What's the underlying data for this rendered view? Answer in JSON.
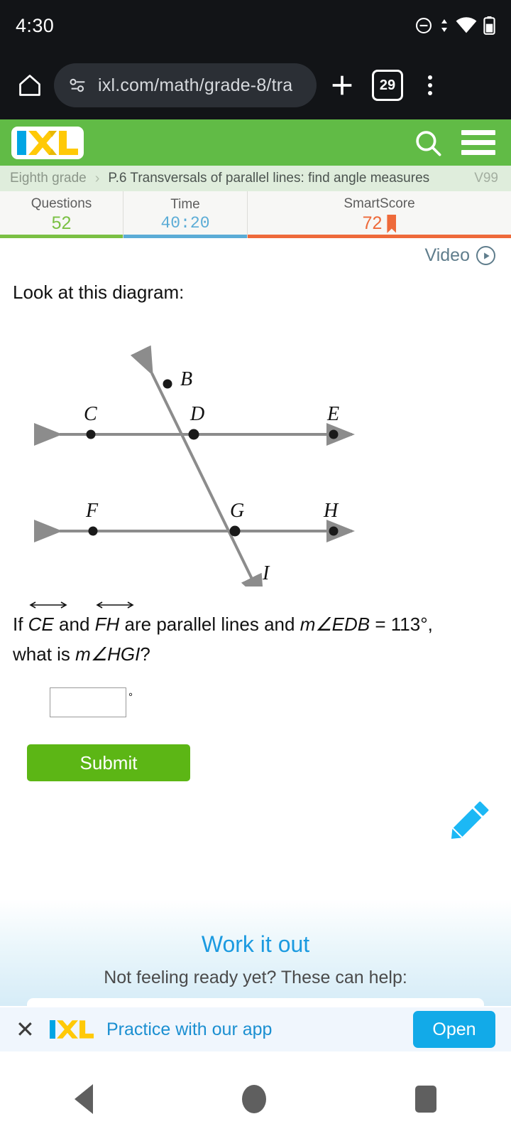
{
  "status_bar": {
    "time": "4:30",
    "icons": [
      "do-not-disturb-icon",
      "data-transfer-icon",
      "wifi-icon",
      "battery-icon"
    ]
  },
  "browser": {
    "home_icon": "home-icon",
    "site_info_icon": "site-settings-icon",
    "url": "ixl.com/math/grade-8/tra",
    "new_tab_icon": "plus-icon",
    "tab_count": "29",
    "menu_icon": "more-vertical-icon"
  },
  "ixl_header": {
    "logo_text": "IXL",
    "search_icon": "search-icon",
    "menu_icon": "hamburger-icon",
    "brand_green": "#61bb46",
    "logo_blue": "#00a5e4",
    "logo_yellow": "#ffc907"
  },
  "breadcrumb": {
    "grade": "Eighth grade",
    "separator": "›",
    "skill": "P.6 Transversals of parallel lines: find angle measures",
    "code": "V99"
  },
  "stats": {
    "questions": {
      "label": "Questions",
      "value": "52",
      "color": "#7ac043"
    },
    "time": {
      "label": "Time",
      "value": "40:20",
      "color": "#5bacd6"
    },
    "smartscore": {
      "label": "SmartScore",
      "value": "72",
      "color": "#ee6a3a",
      "ribbon": "bookmark-icon"
    }
  },
  "video": {
    "label": "Video",
    "icon": "play-circle-icon"
  },
  "question": {
    "prompt": "Look at this diagram:",
    "line1_a": "If ",
    "seg1": "CE",
    "line1_b": " and ",
    "seg2": "FH",
    "line1_c": " are parallel lines and ",
    "measure1": "m∠EDB",
    "eq": " = ",
    "angle_value": "113°,",
    "line2_a": "what is ",
    "measure2": "m∠HGI",
    "line2_b": "?"
  },
  "diagram": {
    "points": [
      "B",
      "C",
      "D",
      "E",
      "F",
      "G",
      "H",
      "I"
    ],
    "labels": {
      "B": "B",
      "C": "C",
      "D": "D",
      "E": "E",
      "F": "F",
      "G": "G",
      "H": "H",
      "I": "I"
    },
    "line_color": "#808080",
    "point_color": "#1a1a1a"
  },
  "answer": {
    "value": "",
    "placeholder": "",
    "degree_symbol": "°",
    "submit_label": "Submit",
    "submit_color": "#5cb615"
  },
  "pencil": {
    "icon": "pencil-icon",
    "color": "#1cb8f5"
  },
  "work_it_out": {
    "title": "Work it out",
    "subtitle": "Not feeling ready yet? These can help:",
    "title_color": "#1b9ae0"
  },
  "app_banner": {
    "close_icon": "close-icon",
    "logo_text": "IXL",
    "text": "Practice with our app",
    "open_label": "Open",
    "open_color": "#12aae8"
  },
  "android_nav": {
    "back": "back-triangle-icon",
    "home": "home-circle-icon",
    "recents": "recents-square-icon"
  }
}
